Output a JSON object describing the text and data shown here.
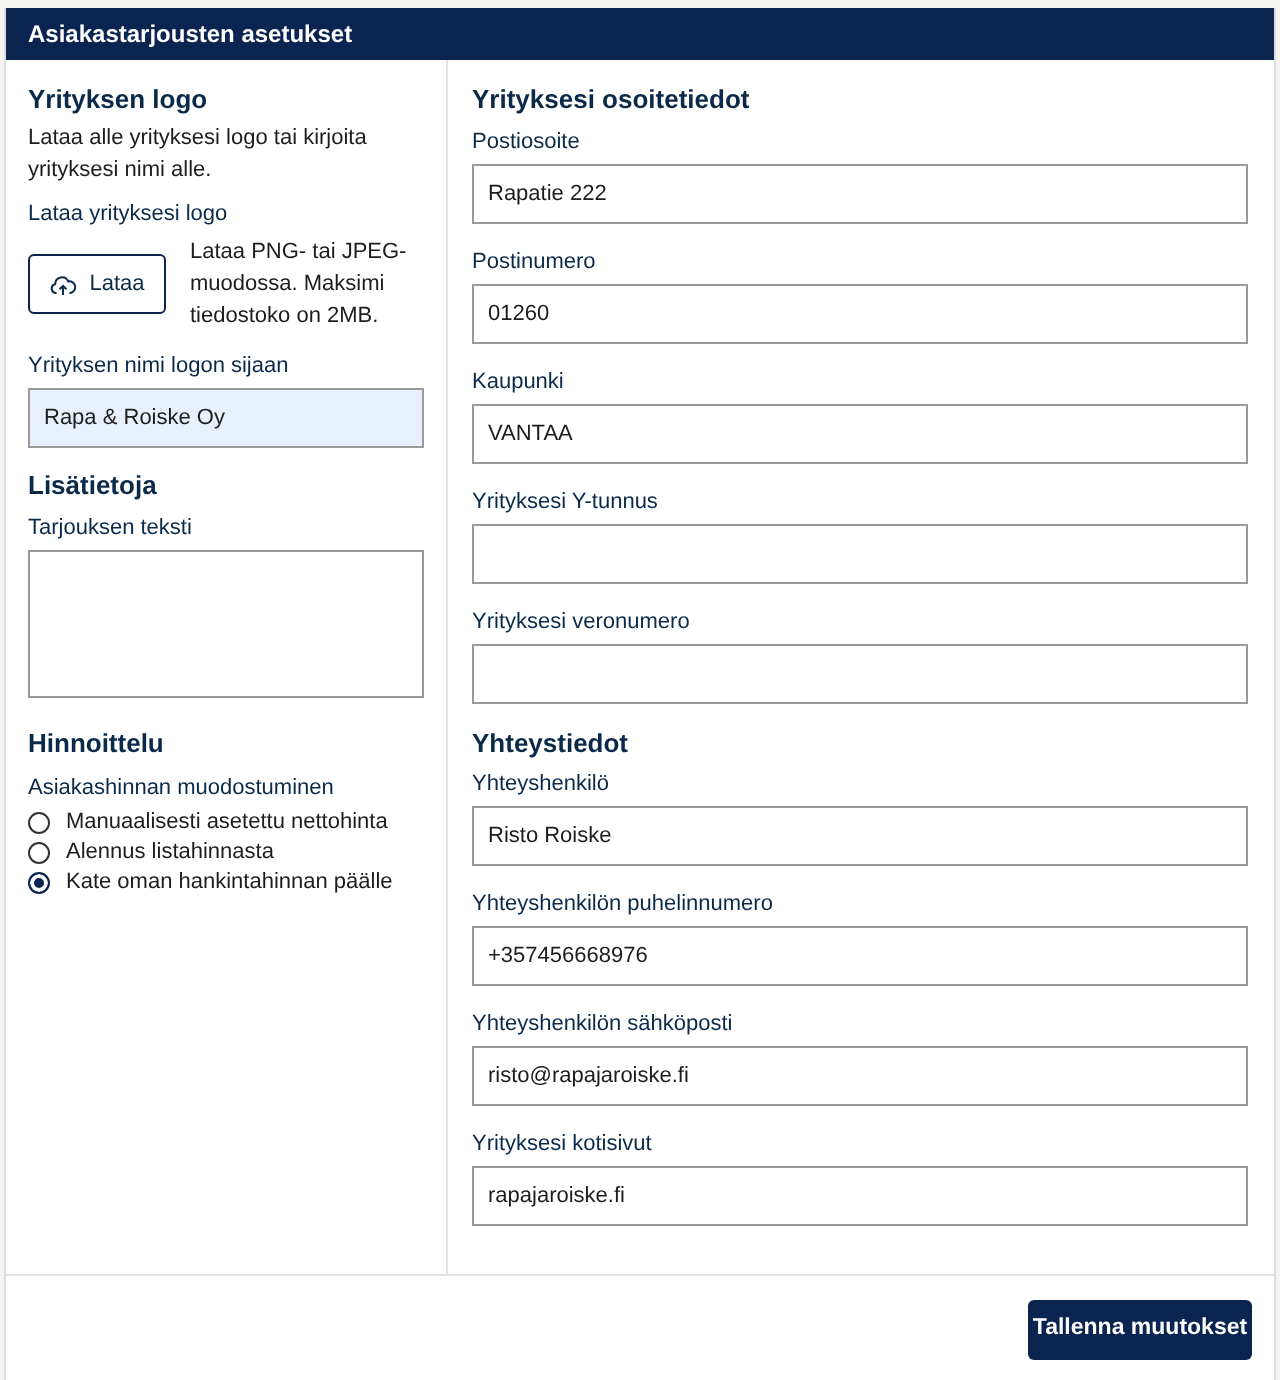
{
  "header": {
    "title": "Asiakastarjousten asetukset"
  },
  "logo_section": {
    "heading": "Yrityksen logo",
    "description": "Lataa alle yrityksesi logo tai kirjoita yrityksesi nimi alle.",
    "upload_label": "Lataa yrityksesi logo",
    "upload_button": "Lataa",
    "upload_hint": "Lataa PNG- tai JPEG-muodossa. Maksimi tiedostoko on 2MB.",
    "name_field": {
      "label": "Yrityksen nimi logon sijaan",
      "value": "Rapa & Roiske Oy",
      "autofilled": true
    }
  },
  "extra_section": {
    "heading": "Lisätietoja",
    "offer_text": {
      "label": "Tarjouksen teksti"
    }
  },
  "pricing_section": {
    "heading": "Hinnoittelu",
    "label": "Asiakashinnan muodostuminen",
    "options": [
      {
        "label": "Manuaalisesti asetettu nettohinta",
        "selected": false
      },
      {
        "label": "Alennus listahinnasta",
        "selected": false
      },
      {
        "label": "Kate oman hankintahinnan päälle",
        "selected": true
      }
    ]
  },
  "address_section": {
    "heading": "Yrityksesi osoitetiedot",
    "fields": [
      {
        "label": "Postiosoite",
        "value": "Rapatie 222"
      },
      {
        "label": "Postinumero",
        "value": "01260"
      },
      {
        "label": "Kaupunki",
        "value": "VANTAA"
      },
      {
        "label": "Yrityksesi Y-tunnus"
      },
      {
        "label": "Yrityksesi veronumero"
      }
    ]
  },
  "contact_section": {
    "heading": "Yhteystiedot",
    "fields": [
      {
        "label": "Yhteyshenkilö",
        "value": "Risto Roiske"
      },
      {
        "label": "Yhteyshenkilön puhelinnumero",
        "value": "+357456668976"
      },
      {
        "label": "Yhteyshenkilön sähköposti",
        "value": "risto@rapajaroiske.fi"
      },
      {
        "label": "Yrityksesi kotisivut",
        "value": "rapajaroiske.fi"
      }
    ]
  },
  "footer": {
    "save_button": "Tallenna muutokset"
  }
}
